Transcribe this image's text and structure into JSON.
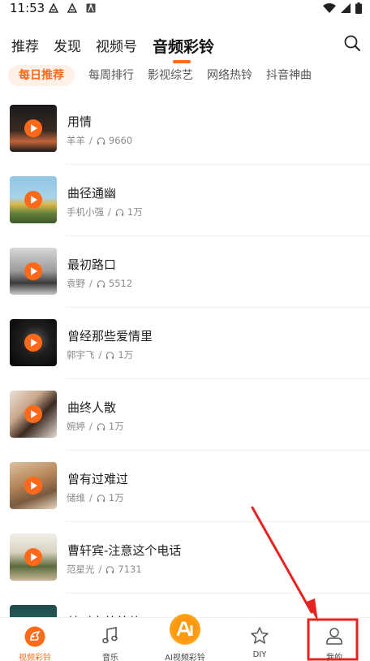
{
  "status_bar": {
    "time": "11:53"
  },
  "top_tabs": [
    {
      "label": "推荐",
      "active": false
    },
    {
      "label": "发现",
      "active": false
    },
    {
      "label": "视频号",
      "active": false
    },
    {
      "label": "音频彩铃",
      "active": true
    }
  ],
  "sub_tabs": [
    {
      "label": "每日推荐",
      "active": true
    },
    {
      "label": "每周排行",
      "active": false
    },
    {
      "label": "影视综艺",
      "active": false
    },
    {
      "label": "网络热铃",
      "active": false
    },
    {
      "label": "抖音神曲",
      "active": false
    }
  ],
  "songs": [
    {
      "title": "用情",
      "artist": "羊羊",
      "plays": "9660"
    },
    {
      "title": "曲径通幽",
      "artist": "手机小强",
      "plays": "1万"
    },
    {
      "title": "最初路口",
      "artist": "袁野",
      "plays": "5512"
    },
    {
      "title": "曾经那些爱情里",
      "artist": "郭宇飞",
      "plays": "1万"
    },
    {
      "title": "曲终人散",
      "artist": "婉婷",
      "plays": "1万"
    },
    {
      "title": "曾有过难过",
      "artist": "储维",
      "plays": "1万"
    },
    {
      "title": "曹轩宾-注意这个电话",
      "artist": "范星光",
      "plays": "7131"
    },
    {
      "title": "林叫人美美共",
      "artist": "",
      "plays": ""
    }
  ],
  "separator": "/",
  "bottom_nav": [
    {
      "label": "视频彩铃",
      "icon": "video-ringtone-icon",
      "active": true
    },
    {
      "label": "音乐",
      "icon": "music-note-icon",
      "active": false
    },
    {
      "label": "AI视频彩铃",
      "icon": "ai-logo-icon",
      "active": false
    },
    {
      "label": "DIY",
      "icon": "star-icon",
      "active": false
    },
    {
      "label": "我的",
      "icon": "user-icon",
      "active": false
    }
  ],
  "colors": {
    "accent": "#ff6a1a",
    "annotation": "#e8231f"
  }
}
